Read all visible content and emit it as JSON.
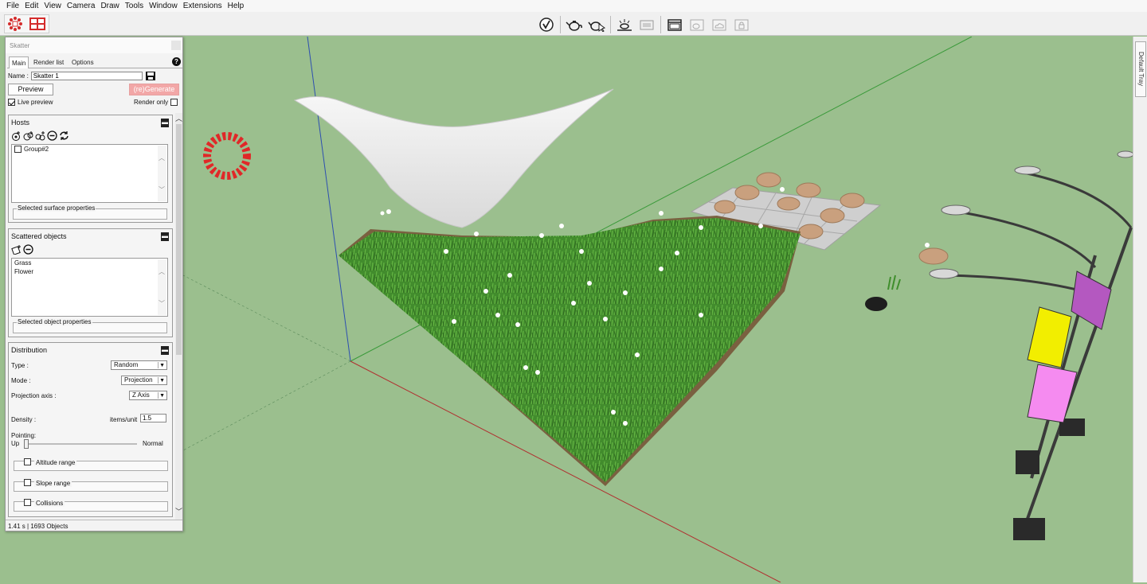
{
  "menu": [
    "File",
    "Edit",
    "View",
    "Camera",
    "Draw",
    "Tools",
    "Window",
    "Extensions",
    "Help"
  ],
  "toolbar": {
    "left_icons": [
      "scatter-icon",
      "scatter-grid-icon"
    ],
    "center_icons": [
      "vray-logo-icon",
      "teapot-render-icon",
      "teapot-interactive-icon",
      "light-gen-icon",
      "frame-buffer-icon",
      "asset-editor-icon",
      "batch-render-icon",
      "cloud-render-icon",
      "lock-icon"
    ]
  },
  "tray": {
    "label": "Default Tray"
  },
  "panel": {
    "title": "Skatter",
    "tabs": [
      "Main",
      "Render list",
      "Options"
    ],
    "name_label": "Name :",
    "name_value": "Skatter 1",
    "preview_label": "Preview",
    "generate_label": "(re)Generate",
    "live_preview_label": "Live preview",
    "render_only_label": "Render only",
    "hosts": {
      "title": "Hosts",
      "items": [
        "Group#2"
      ],
      "props_label": "Selected surface properties"
    },
    "scattered": {
      "title": "Scattered objects",
      "items": [
        "Grass",
        "Flower"
      ],
      "props_label": "Selected object properties"
    },
    "distribution": {
      "title": "Distribution",
      "type_label": "Type :",
      "type_value": "Random",
      "mode_label": "Mode :",
      "mode_value": "Projection",
      "axis_label": "Projection axis :",
      "axis_value": "Z Axis",
      "density_label": "Density :",
      "density_unit": "items/unit",
      "density_value": "1.5",
      "pointing_label": "Pointing:",
      "pointing_left": "Up",
      "pointing_right": "Normal",
      "pointing_level": 0,
      "altitude_label": "Altitude range",
      "slope_label": "Slope range",
      "collisions_label": "Collisions"
    },
    "status": "1.41 s | 1693 Objects"
  }
}
